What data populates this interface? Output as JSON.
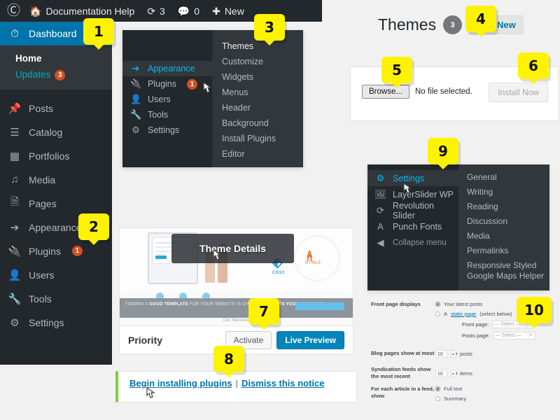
{
  "adminbar": {
    "logo_icon": "wordpress-logo-icon",
    "home_icon": "home-icon",
    "site_name": "Documentation Help",
    "updates_icon": "updates-icon",
    "updates_count": "3",
    "comments_icon": "comment-bubble-icon",
    "comments_count": "0",
    "new_icon": "plus-icon",
    "new_label": "New"
  },
  "sidebar": {
    "dashboard": {
      "label": "Dashboard",
      "icon": "dashboard-gauge-icon"
    },
    "dashboard_sub": [
      {
        "label": "Home"
      },
      {
        "label": "Updates",
        "count": "3"
      }
    ],
    "items": [
      {
        "label": "Posts",
        "icon": "pin-icon"
      },
      {
        "label": "Catalog",
        "icon": "list-icon"
      },
      {
        "label": "Portfolios",
        "icon": "portfolio-icon"
      },
      {
        "label": "Media",
        "icon": "media-icon"
      },
      {
        "label": "Pages",
        "icon": "pages-icon"
      },
      {
        "label": "Appearance",
        "icon": "paintbrush-icon"
      },
      {
        "label": "Plugins",
        "icon": "plug-icon",
        "count": "1"
      },
      {
        "label": "Users",
        "icon": "user-icon"
      },
      {
        "label": "Tools",
        "icon": "wrench-icon"
      },
      {
        "label": "Settings",
        "icon": "settings-sliders-icon"
      }
    ]
  },
  "flyout_appearance": {
    "main_items": [
      {
        "label": "Appearance",
        "icon": "paintbrush-icon",
        "current": true
      },
      {
        "label": "Plugins",
        "icon": "plug-icon",
        "count": "1"
      },
      {
        "label": "Users",
        "icon": "user-icon"
      },
      {
        "label": "Tools",
        "icon": "wrench-icon"
      },
      {
        "label": "Settings",
        "icon": "settings-sliders-icon"
      }
    ],
    "sub_items": [
      {
        "label": "Themes"
      },
      {
        "label": "Customize"
      },
      {
        "label": "Widgets"
      },
      {
        "label": "Menus"
      },
      {
        "label": "Header"
      },
      {
        "label": "Background"
      },
      {
        "label": "Install Plugins"
      },
      {
        "label": "Editor"
      }
    ]
  },
  "themes_header": {
    "title": "Themes",
    "count": "3",
    "add_new_label": "Add New"
  },
  "upload_panel": {
    "browse_label": "Browse...",
    "no_file_text": "No file selected.",
    "install_label": "Install Now"
  },
  "flyout_settings": {
    "main_items": [
      {
        "label": "Settings",
        "icon": "settings-sliders-icon",
        "current": true
      },
      {
        "label": "LayerSlider WP",
        "icon": "layerslider-icon"
      },
      {
        "label": "Revolution Slider",
        "icon": "revolution-slider-icon"
      },
      {
        "label": "Punch Fonts",
        "icon": "font-a-icon"
      },
      {
        "label": "Collapse menu",
        "icon": "collapse-arrow-icon",
        "dim": true
      }
    ],
    "sub_items": [
      {
        "label": "General"
      },
      {
        "label": "Writing"
      },
      {
        "label": "Reading"
      },
      {
        "label": "Discussion"
      },
      {
        "label": "Media"
      },
      {
        "label": "Permalinks"
      },
      {
        "label": "Responsive Styled Google Maps Helper"
      }
    ]
  },
  "theme_card": {
    "overlay_label": "Theme Details",
    "name": "Priority",
    "activate_label": "Activate",
    "live_preview_label": "Live Preview",
    "shot_banner_pre": "FINDING A ",
    "shot_banner_bold": "GOOD TEMPLATE",
    "shot_banner_mid": " FOR YOUR WEBSITE IS CHALLENGING. ",
    "shot_banner_bold2": "ITS YOUR CALL NOW.",
    "shot_services": "Our Services",
    "shot_css3": "CSS3",
    "shot_html5": "HTML5"
  },
  "notice": {
    "begin_label": "Begin installing plugins",
    "separator": "|",
    "dismiss_label": "Dismiss this notice"
  },
  "reading_settings": {
    "front_page_displays_label": "Front page displays",
    "latest_posts_label": "Your latest posts",
    "static_page_prefix": "A ",
    "static_page_link": "static page",
    "static_page_suffix": " (select below)",
    "front_page_label": "Front page:",
    "posts_page_label": "Posts page:",
    "select_placeholder": "— Select —",
    "blog_pages_label": "Blog pages show at most",
    "blog_pages_value": "10",
    "blog_pages_unit": "posts",
    "syndication_label": "Syndication feeds show the most recent",
    "syndication_value": "10",
    "syndication_unit": "items",
    "feed_article_label": "For each article in a feed, show",
    "full_text_label": "Full text",
    "summary_label": "Summary"
  },
  "callouts": [
    {
      "number": "1"
    },
    {
      "number": "2"
    },
    {
      "number": "3"
    },
    {
      "number": "4"
    },
    {
      "number": "5"
    },
    {
      "number": "6"
    },
    {
      "number": "7"
    },
    {
      "number": "8"
    },
    {
      "number": "9"
    },
    {
      "number": "10"
    }
  ],
  "colors": {
    "admin_dark": "#23282d",
    "admin_dark2": "#32373c",
    "accent_blue": "#0073aa",
    "link_blue": "#00b9eb",
    "badge_orange": "#d54e21",
    "callout_yellow": "#fdf200",
    "notice_green": "#7ad03a",
    "page_bg": "#f1f1f1"
  }
}
